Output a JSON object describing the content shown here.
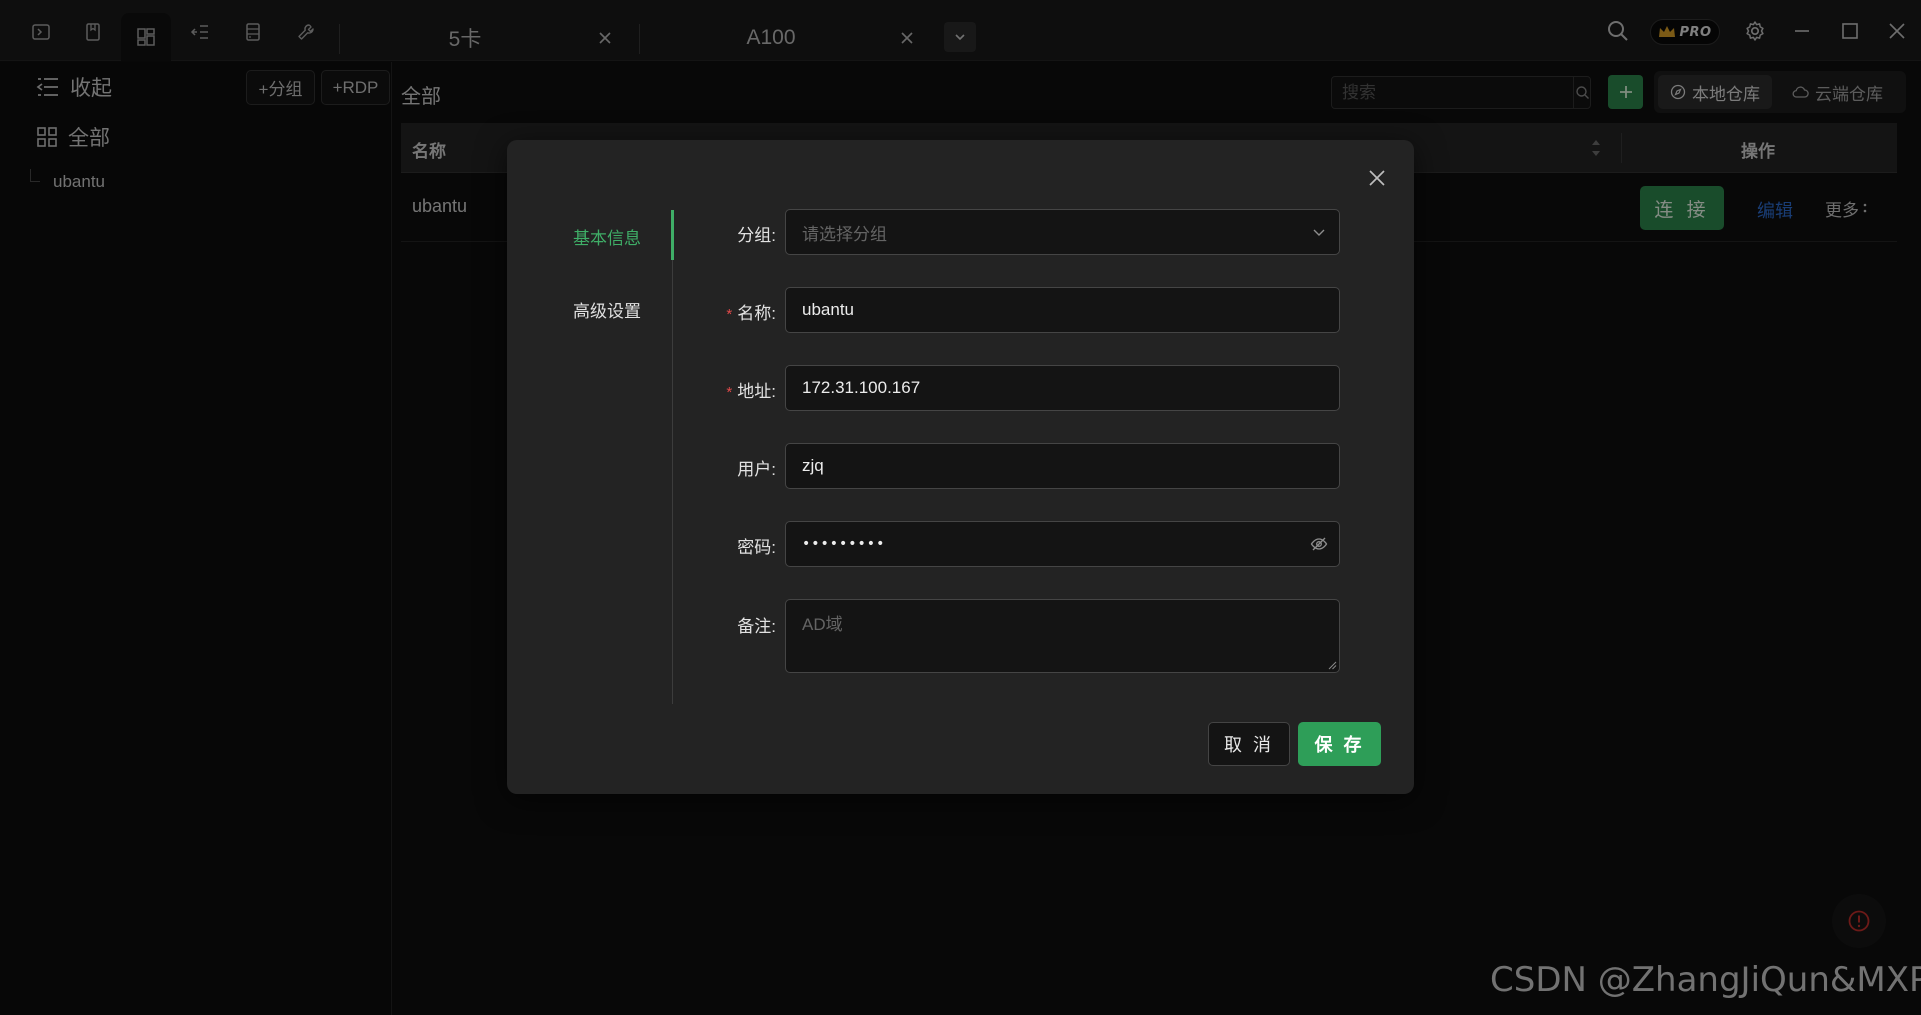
{
  "titlebar": {
    "tabs": [
      {
        "label": "5卡"
      },
      {
        "label": "A100"
      }
    ],
    "pro_badge": "PRO"
  },
  "sidebar": {
    "collapse_label": "收起",
    "add_group_label": "+分组",
    "add_rdp_label": "+RDP",
    "all_label": "全部",
    "tree_items": [
      {
        "label": "ubantu"
      }
    ]
  },
  "main": {
    "breadcrumb": "全部",
    "search_placeholder": "搜索",
    "local_repo_label": "本地仓库",
    "cloud_repo_label": "云端仓库",
    "table": {
      "col_name": "名称",
      "col_actions": "操作",
      "rows": [
        {
          "name": "ubantu",
          "connect_label": "连 接",
          "edit_label": "编辑",
          "more_label": "更多"
        }
      ]
    },
    "watermark": "CSDN @ZhangJiQun&MXP"
  },
  "dialog": {
    "tabs": {
      "basic_info": "基本信息",
      "advanced": "高级设置"
    },
    "form": {
      "group_label": "分组:",
      "group_placeholder": "请选择分组",
      "name_label": "名称:",
      "name_value": "ubantu",
      "address_label": "地址:",
      "address_value": "172.31.100.167",
      "user_label": "用户:",
      "user_value": "zjq",
      "password_label": "密码:",
      "password_value": "•••••••••",
      "note_label": "备注:",
      "note_placeholder": "AD域"
    },
    "cancel_label": "取 消",
    "save_label": "保 存"
  },
  "colors": {
    "accent_green": "#2e9e58",
    "link_blue": "#2f6fd6",
    "required_red": "#e04a4a"
  }
}
